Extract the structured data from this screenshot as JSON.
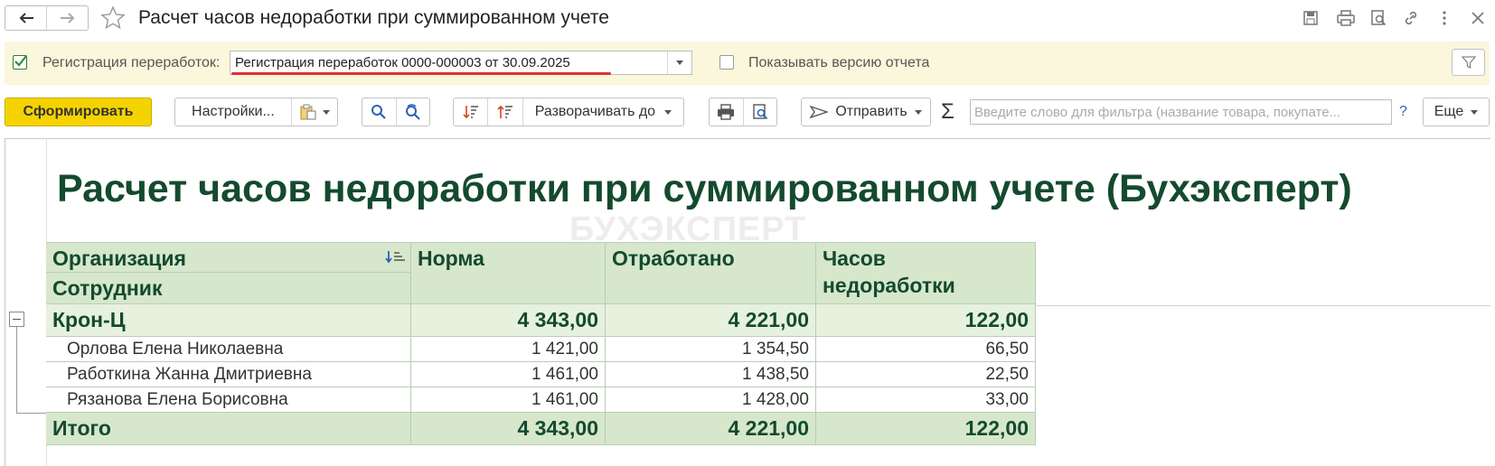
{
  "window": {
    "title": "Расчет часов недоработки при суммированном учете"
  },
  "params": {
    "registration_label": "Регистрация переработок:",
    "registration_checked": true,
    "registration_value": "Регистрация переработок 0000-000003 от 30.09.2025",
    "show_version_label": "Показывать версию отчета",
    "show_version_checked": false
  },
  "toolbar": {
    "generate_label": "Сформировать",
    "settings_label": "Настройки...",
    "expand_label": "Разворачивать до",
    "send_label": "Отправить",
    "sum_symbol": "Σ",
    "filter_placeholder": "Введите слово для фильтра (название товара, покупате...",
    "help_label": "?",
    "more_label": "Еще"
  },
  "report": {
    "title": "Расчет часов недоработки при суммированном учете (Бухэксперт)",
    "watermark": "БУХЭКСПЕРТ",
    "headers": {
      "organization": "Организация",
      "employee": "Сотрудник",
      "norm": "Норма",
      "worked": "Отработано",
      "shortfall_line1": "Часов",
      "shortfall_line2": "недоработки"
    },
    "group": {
      "name": "Крон-Ц",
      "norm": "4 343,00",
      "worked": "4 221,00",
      "shortfall": "122,00"
    },
    "rows": [
      {
        "name": "Орлова Елена Николаевна",
        "norm": "1 421,00",
        "worked": "1 354,50",
        "shortfall": "66,50"
      },
      {
        "name": "Работкина Жанна Дмитриевна",
        "norm": "1 461,00",
        "worked": "1 438,50",
        "shortfall": "22,50"
      },
      {
        "name": "Рязанова Елена Борисовна",
        "norm": "1 461,00",
        "worked": "1 428,00",
        "shortfall": "33,00"
      }
    ],
    "total": {
      "label": "Итого",
      "norm": "4 343,00",
      "worked": "4 221,00",
      "shortfall": "122,00"
    }
  },
  "colors": {
    "primary_button": "#f5d300",
    "header_fill": "#d6e7cc",
    "report_text": "#144a2e",
    "params_bg": "#fbf7dc",
    "underline": "#e03030"
  }
}
